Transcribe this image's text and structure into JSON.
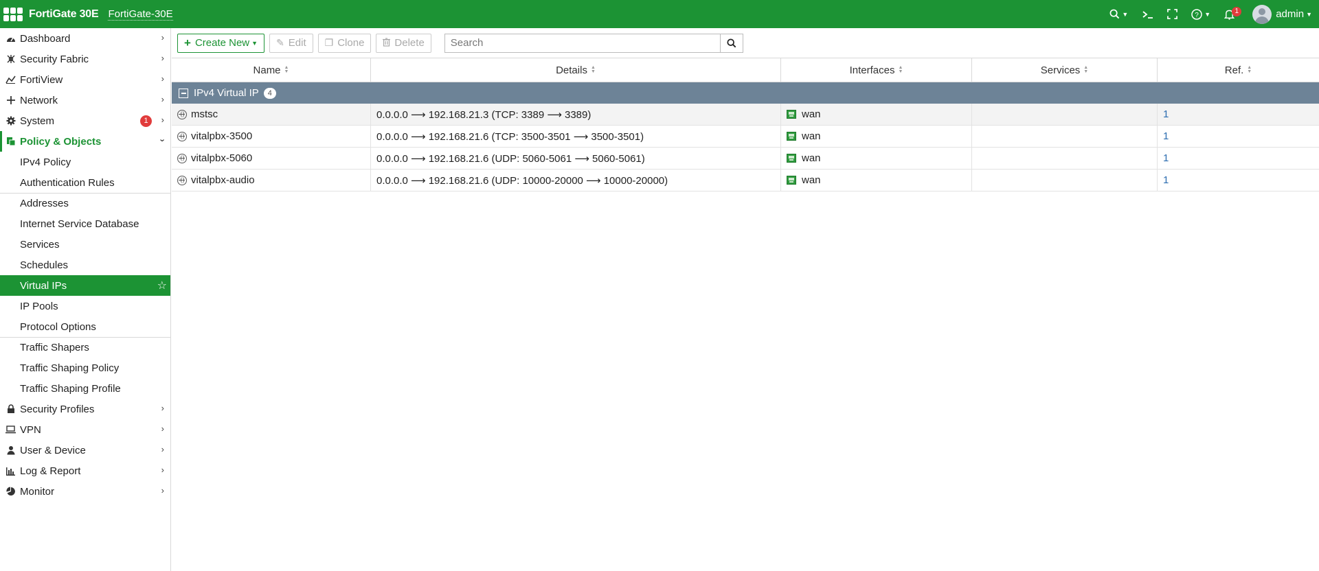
{
  "header": {
    "product": "FortiGate 30E",
    "hostname": "FortiGate-30E",
    "notification_count": "1",
    "user": "admin"
  },
  "sidebar": {
    "items": [
      {
        "label": "Dashboard",
        "icon": "dashboard-icon"
      },
      {
        "label": "Security Fabric",
        "icon": "security-fabric-icon"
      },
      {
        "label": "FortiView",
        "icon": "fortiview-icon"
      },
      {
        "label": "Network",
        "icon": "network-icon"
      },
      {
        "label": "System",
        "icon": "gear-icon",
        "badge": "1"
      },
      {
        "label": "Policy & Objects",
        "icon": "policy-icon"
      }
    ],
    "sub_items": [
      {
        "label": "IPv4 Policy"
      },
      {
        "label": "Authentication Rules"
      },
      {
        "label": "Addresses"
      },
      {
        "label": "Internet Service Database"
      },
      {
        "label": "Services"
      },
      {
        "label": "Schedules"
      },
      {
        "label": "Virtual IPs"
      },
      {
        "label": "IP Pools"
      },
      {
        "label": "Protocol Options"
      },
      {
        "label": "Traffic Shapers"
      },
      {
        "label": "Traffic Shaping Policy"
      },
      {
        "label": "Traffic Shaping Profile"
      }
    ],
    "bottom_items": [
      {
        "label": "Security Profiles",
        "icon": "lock-icon"
      },
      {
        "label": "VPN",
        "icon": "vpn-icon"
      },
      {
        "label": "User & Device",
        "icon": "user-icon"
      },
      {
        "label": "Log & Report",
        "icon": "log-report-icon"
      },
      {
        "label": "Monitor",
        "icon": "monitor-icon"
      }
    ]
  },
  "toolbar": {
    "create_new": "Create New",
    "edit": "Edit",
    "clone": "Clone",
    "delete": "Delete",
    "search_placeholder": "Search"
  },
  "table": {
    "columns": [
      "Name",
      "Details",
      "Interfaces",
      "Services",
      "Ref."
    ],
    "group": {
      "label": "IPv4 Virtual IP",
      "count": "4"
    },
    "rows": [
      {
        "name": "mstsc",
        "details": "0.0.0.0 ⟶ 192.168.21.3 (TCP: 3389 ⟶ 3389)",
        "interface": "wan",
        "services": "",
        "ref": "1"
      },
      {
        "name": "vitalpbx-3500",
        "details": "0.0.0.0 ⟶ 192.168.21.6 (TCP: 3500-3501 ⟶ 3500-3501)",
        "interface": "wan",
        "services": "",
        "ref": "1"
      },
      {
        "name": "vitalpbx-5060",
        "details": "0.0.0.0 ⟶ 192.168.21.6 (UDP: 5060-5061 ⟶ 5060-5061)",
        "interface": "wan",
        "services": "",
        "ref": "1"
      },
      {
        "name": "vitalpbx-audio",
        "details": "0.0.0.0 ⟶ 192.168.21.6 (UDP: 10000-20000 ⟶ 10000-20000)",
        "interface": "wan",
        "services": "",
        "ref": "1"
      }
    ]
  },
  "colors": {
    "brand_green": "#1c9334",
    "group_header": "#6d8397",
    "link_blue": "#2b6cb0",
    "badge_red": "#e13c3c"
  }
}
